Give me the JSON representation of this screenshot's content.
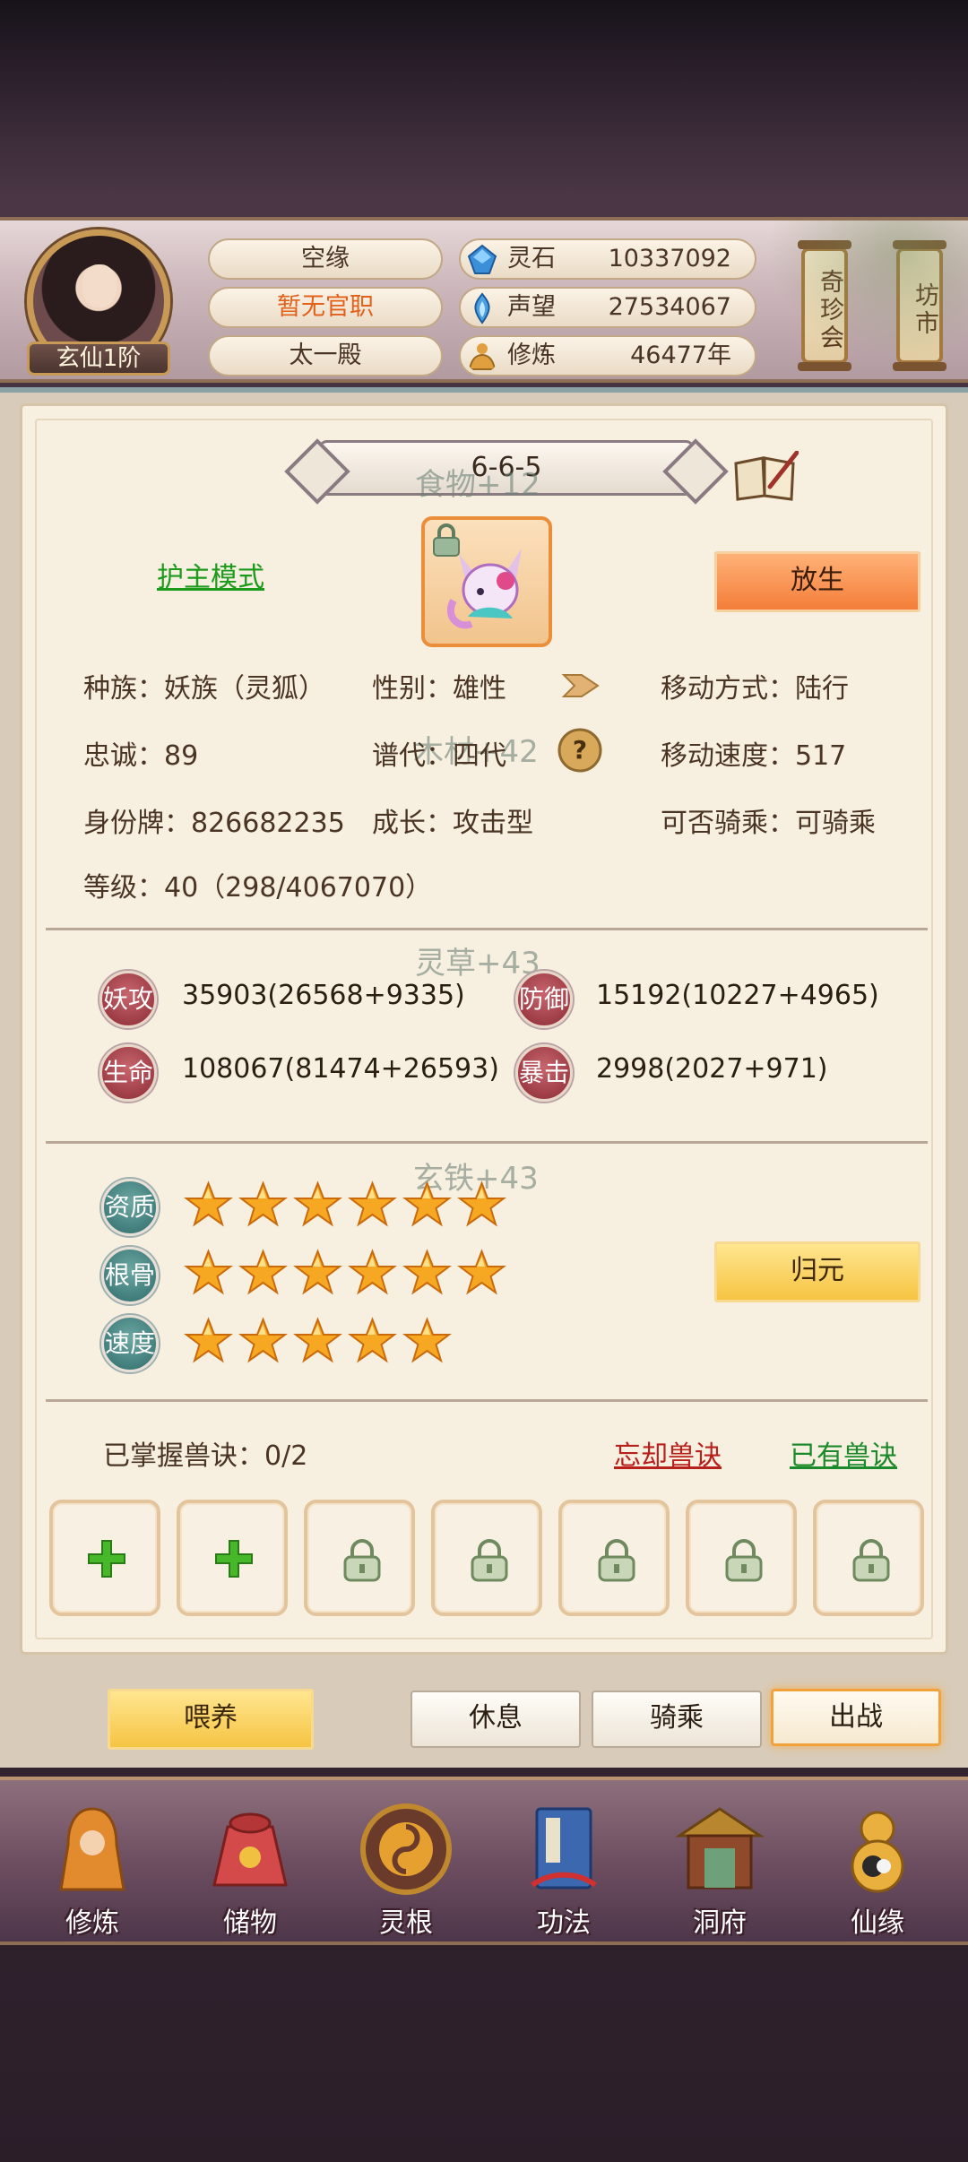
{
  "header": {
    "player_name": "空缘",
    "official_rank": "暂无官职",
    "sect": "太一殿",
    "realm": "玄仙1阶",
    "resources": [
      {
        "label": "灵石",
        "value": "10337092",
        "icon": "spirit-stone-icon",
        "color": "#3b8fd8"
      },
      {
        "label": "声望",
        "value": "27534067",
        "icon": "prestige-icon",
        "color": "#4aa0e0"
      },
      {
        "label": "修炼",
        "value": "46477年",
        "icon": "meditation-icon",
        "color": "#e0a040"
      }
    ],
    "side_buttons": [
      {
        "label": "奇珍会"
      },
      {
        "label": "坊市"
      }
    ]
  },
  "panel": {
    "title": "6-6-5",
    "floating_texts": [
      "食物+12",
      "木材+42",
      "灵草+43",
      "玄铁+43"
    ],
    "guard_mode": "护主模式",
    "release_button": "放生",
    "info": {
      "race": "种族：妖族（灵狐）",
      "gender": "性别：雄性",
      "move_type": "移动方式：陆行",
      "loyalty": "忠诚：89",
      "generation": "谱代：四代",
      "move_speed": "移动速度：517",
      "id_tag": "身份牌：826682235",
      "growth": "成长：攻击型",
      "rideable": "可否骑乘：可骑乘",
      "level": "等级：40（298/4067070）"
    },
    "stats": [
      {
        "badge": "妖攻",
        "value": "35903(26568+9335)"
      },
      {
        "badge": "防御",
        "value": "15192(10227+4965)"
      },
      {
        "badge": "生命",
        "value": "108067(81474+26593)"
      },
      {
        "badge": "暴击",
        "value": "2998(2027+971)"
      }
    ],
    "aptitudes": [
      {
        "badge": "资质",
        "stars": 6
      },
      {
        "badge": "根骨",
        "stars": 6
      },
      {
        "badge": "速度",
        "stars": 5
      }
    ],
    "return_button": "归元",
    "skills": {
      "mastered": "已掌握兽诀：0/2",
      "forget_link": "忘却兽诀",
      "owned_link": "已有兽诀",
      "slots": [
        "add",
        "add",
        "locked",
        "locked",
        "locked",
        "locked",
        "locked"
      ]
    }
  },
  "actions": {
    "feed": "喂养",
    "rest": "休息",
    "ride": "骑乘",
    "battle": "出战"
  },
  "nav": [
    {
      "label": "修炼",
      "icon": "cultivation-icon"
    },
    {
      "label": "储物",
      "icon": "storage-bag-icon"
    },
    {
      "label": "灵根",
      "icon": "spirit-root-icon"
    },
    {
      "label": "功法",
      "icon": "technique-book-icon"
    },
    {
      "label": "洞府",
      "icon": "cave-mansion-icon"
    },
    {
      "label": "仙缘",
      "icon": "gourd-icon"
    }
  ]
}
